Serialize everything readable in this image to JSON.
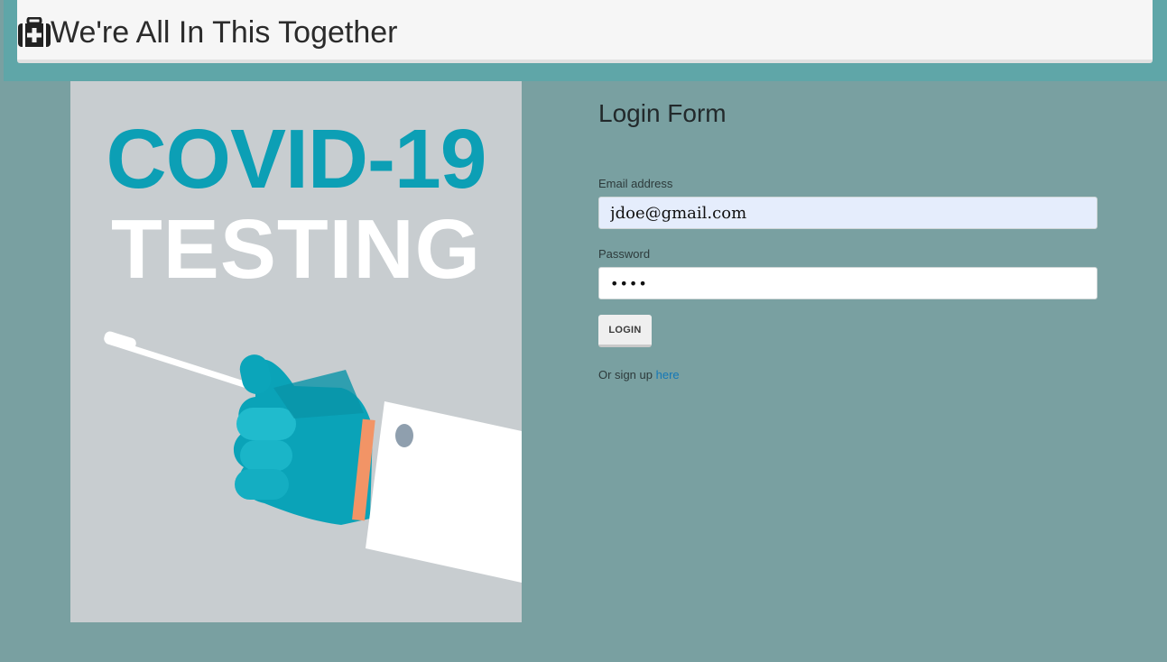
{
  "header": {
    "title": "We're All In This Together",
    "icon": "medkit-icon"
  },
  "poster": {
    "line1": "COVID-19",
    "line2": "TESTING",
    "accent_color": "#0c9fb5",
    "background_color": "#c8cdd0"
  },
  "login_form": {
    "title": "Login Form",
    "email_label": "Email address",
    "email_value": "jdoe@gmail.com",
    "password_label": "Password",
    "password_value": "••••",
    "login_button": "LOGIN",
    "signup_prefix": "Or sign up",
    "signup_link": "here"
  },
  "colors": {
    "page_background": "#79a0a1",
    "topbar": "#5fa6a8",
    "link": "#1478b7"
  }
}
